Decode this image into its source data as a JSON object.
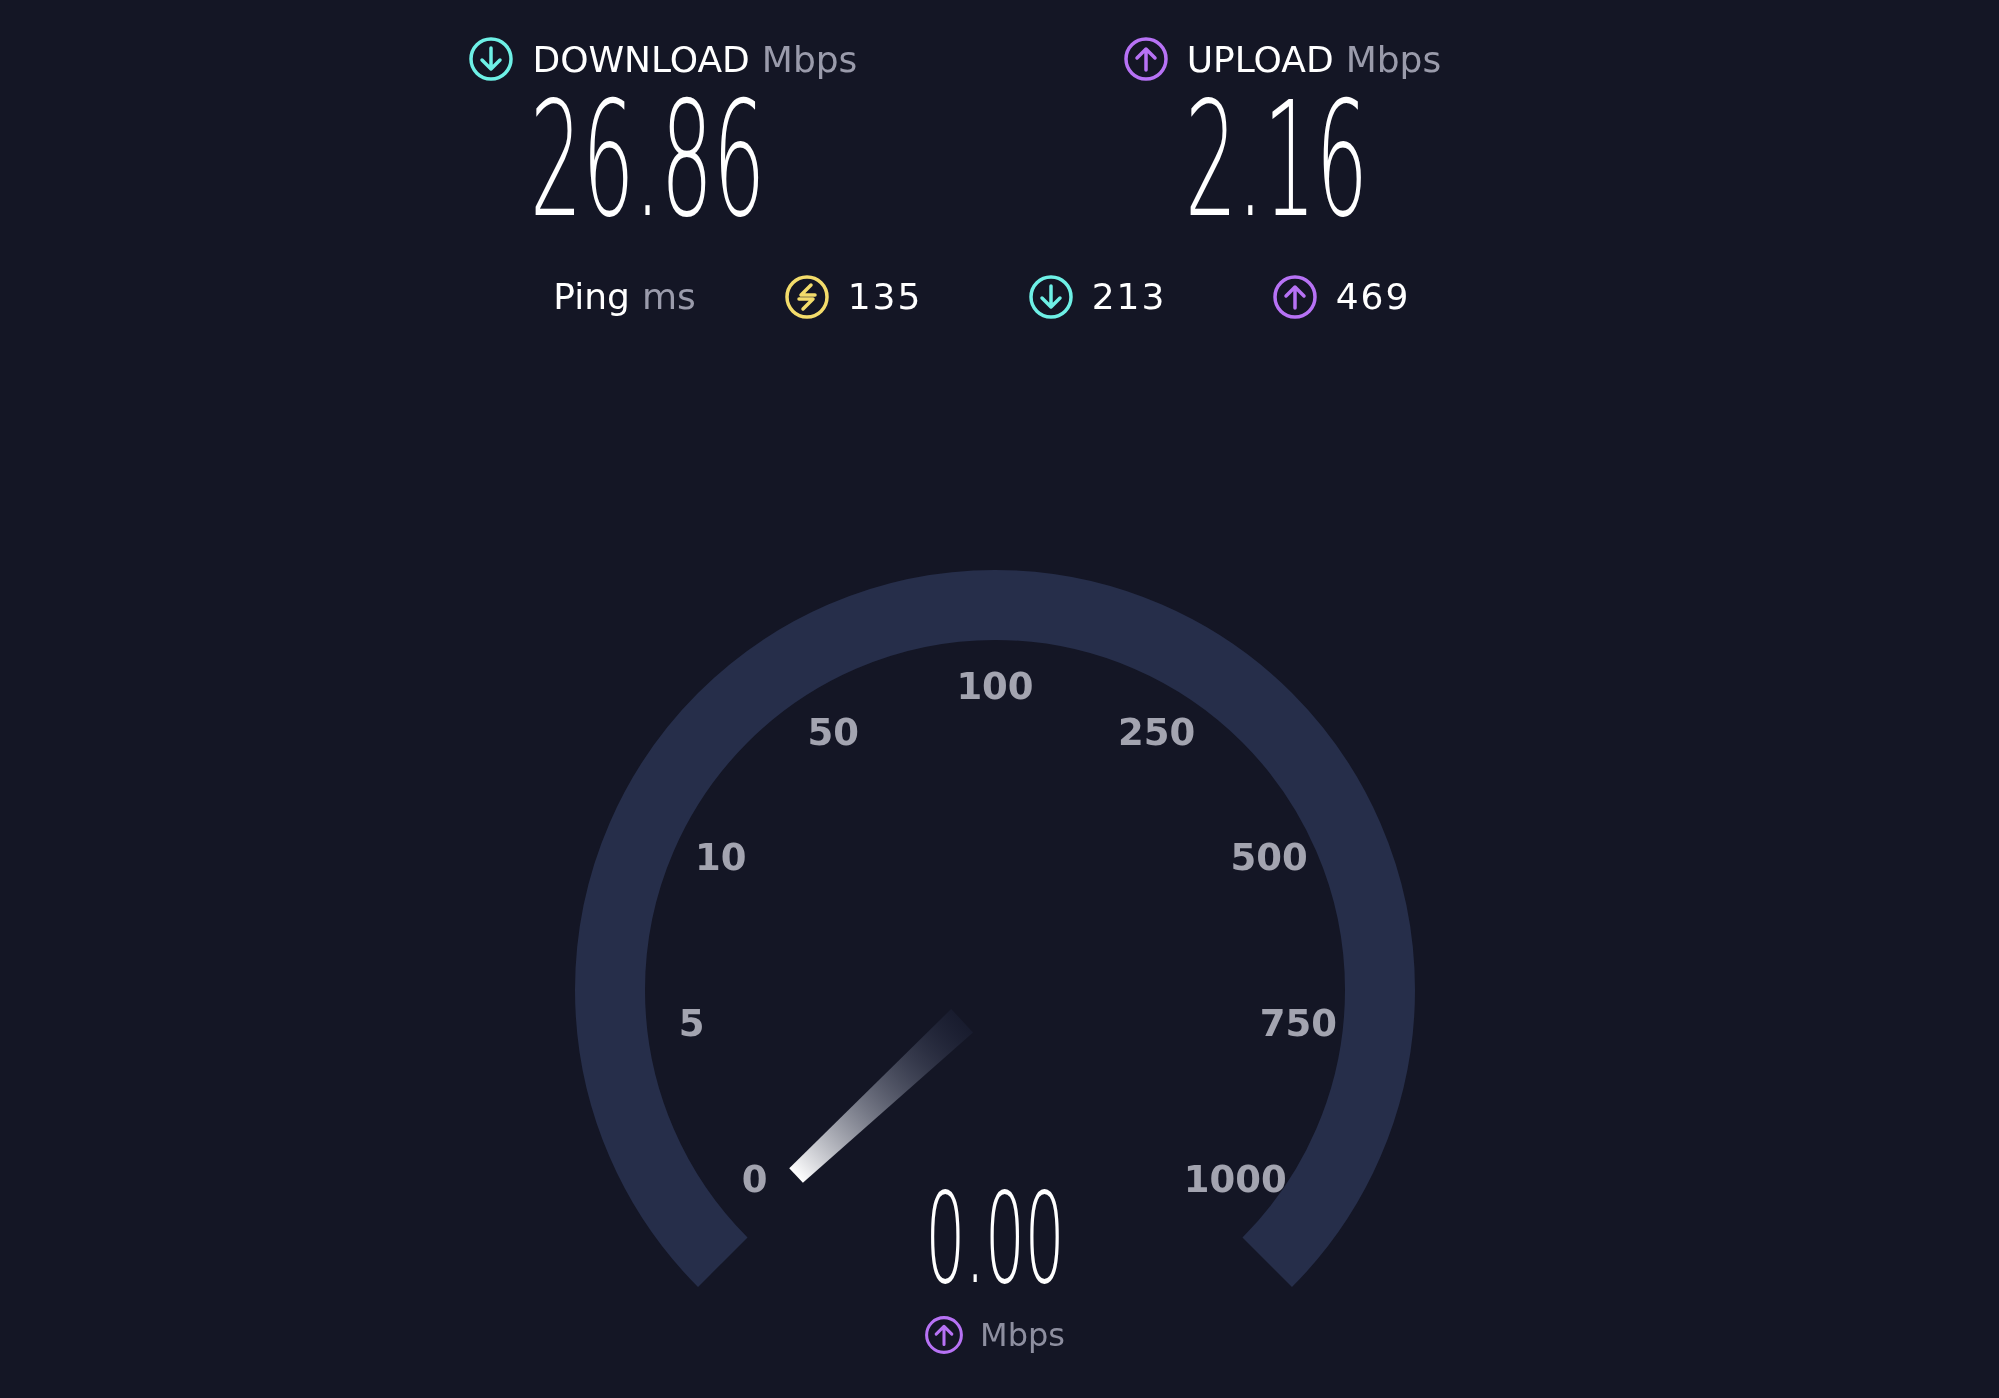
{
  "stats": [
    {
      "kind": "download",
      "label": "DOWNLOAD",
      "unit": "Mbps",
      "value": "26.86"
    },
    {
      "kind": "upload",
      "label": "UPLOAD",
      "unit": "Mbps",
      "value": "2.16"
    }
  ],
  "ping": {
    "label": "Ping",
    "unit": "ms",
    "readings": [
      {
        "kind": "idle",
        "value": "135"
      },
      {
        "kind": "download",
        "value": "213"
      },
      {
        "kind": "upload",
        "value": "469"
      }
    ]
  },
  "gauge": {
    "scale": [
      "0",
      "5",
      "10",
      "50",
      "100",
      "250",
      "500",
      "750",
      "1000"
    ],
    "reading": "0.00",
    "unit": "Mbps",
    "kind": "upload"
  }
}
